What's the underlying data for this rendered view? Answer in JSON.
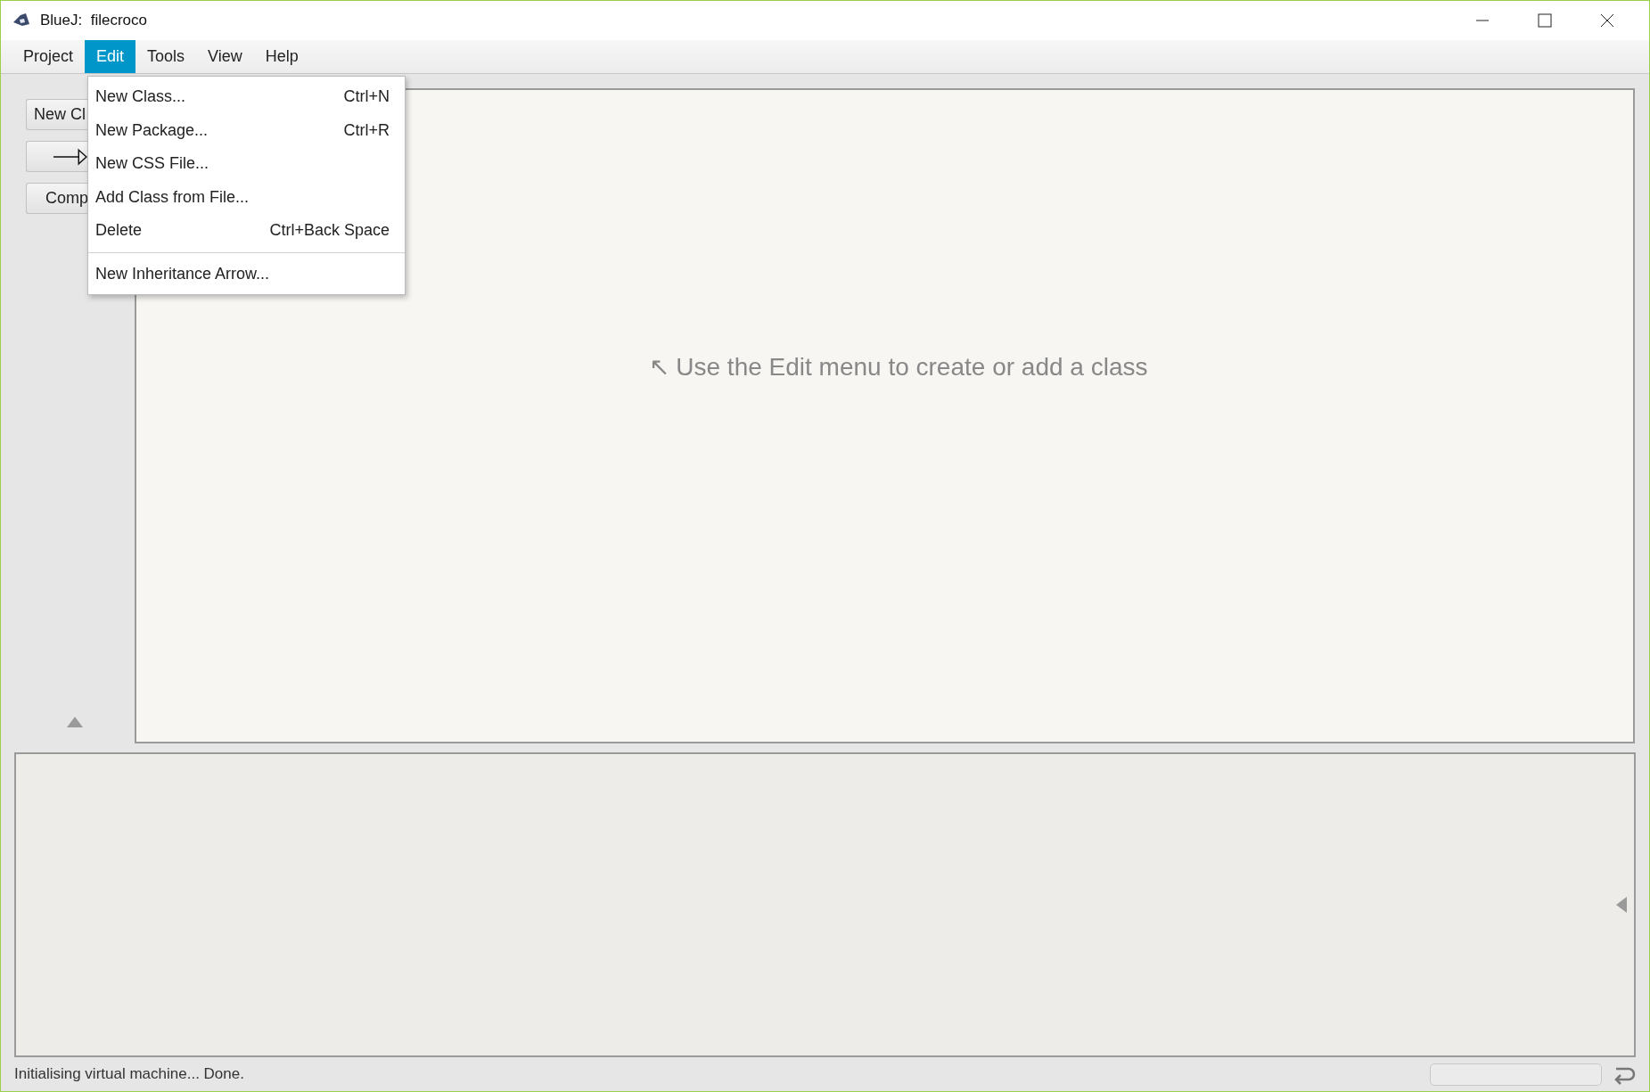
{
  "window": {
    "title": "BlueJ:  filecroco"
  },
  "menu_bar": [
    {
      "label": "Project",
      "selected": false
    },
    {
      "label": "Edit",
      "selected": true
    },
    {
      "label": "Tools",
      "selected": false
    },
    {
      "label": "View",
      "selected": false
    },
    {
      "label": "Help",
      "selected": false
    }
  ],
  "edit_menu": [
    {
      "kind": "item",
      "label": "New Class...",
      "shortcut": "Ctrl+N"
    },
    {
      "kind": "item",
      "label": "New Package...",
      "shortcut": "Ctrl+R"
    },
    {
      "kind": "item",
      "label": "New CSS File..."
    },
    {
      "kind": "item",
      "label": "Add Class from File..."
    },
    {
      "kind": "item",
      "label": "Delete",
      "shortcut": "Ctrl+Back Space"
    },
    {
      "kind": "separator"
    },
    {
      "kind": "item",
      "label": "New Inheritance Arrow..."
    }
  ],
  "sidebar": {
    "buttons": [
      {
        "kind": "text",
        "label": "New Cl"
      },
      {
        "kind": "arrow"
      },
      {
        "kind": "text",
        "label": "Comp"
      }
    ]
  },
  "canvas": {
    "hint": "↖ Use the Edit menu to create or add a class"
  },
  "status_bar": {
    "message": "Initialising virtual machine... Done."
  }
}
